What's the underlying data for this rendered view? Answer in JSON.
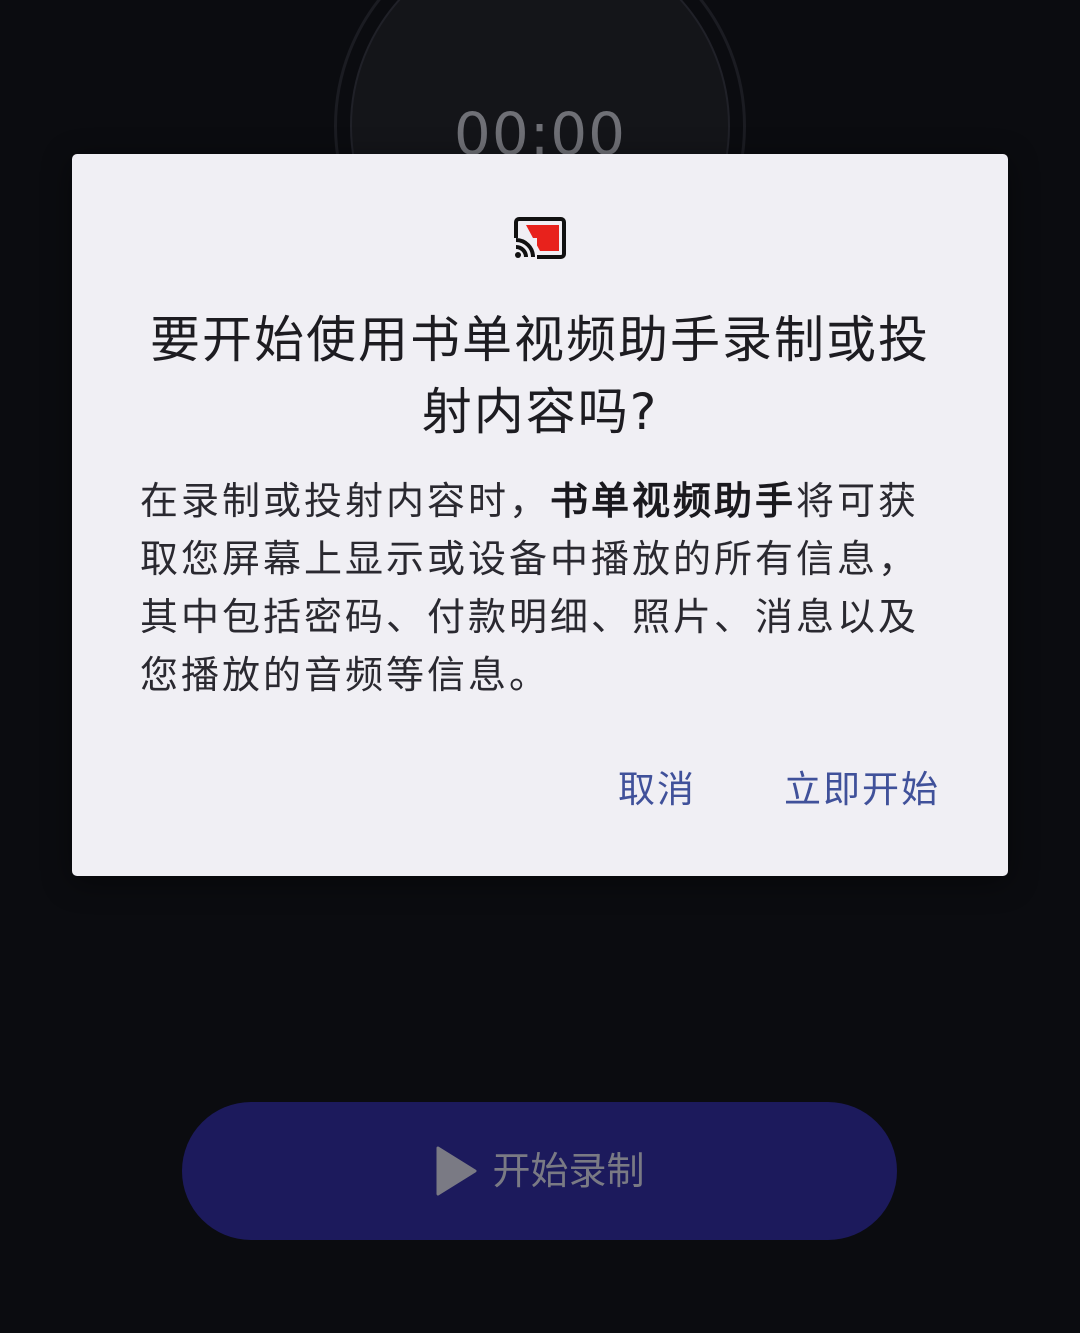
{
  "background": {
    "timer": "00:00",
    "record_button": {
      "label": "开始录制",
      "icon": "play-icon",
      "color": "#1c1a5c"
    }
  },
  "dialog": {
    "icon": "cast-icon",
    "title": "要开始使用书单视频助手录制或投射内容吗?",
    "body": {
      "prefix": "在录制或投射内容时，",
      "app_name": "书单视频助手",
      "suffix": "将可获取您屏幕上显示或设备中播放的所有信息，其中包括密码、付款明细、照片、消息以及您播放的音频等信息。"
    },
    "actions": {
      "cancel_label": "取消",
      "start_label": "立即开始"
    },
    "accent_color": "#40519a"
  }
}
